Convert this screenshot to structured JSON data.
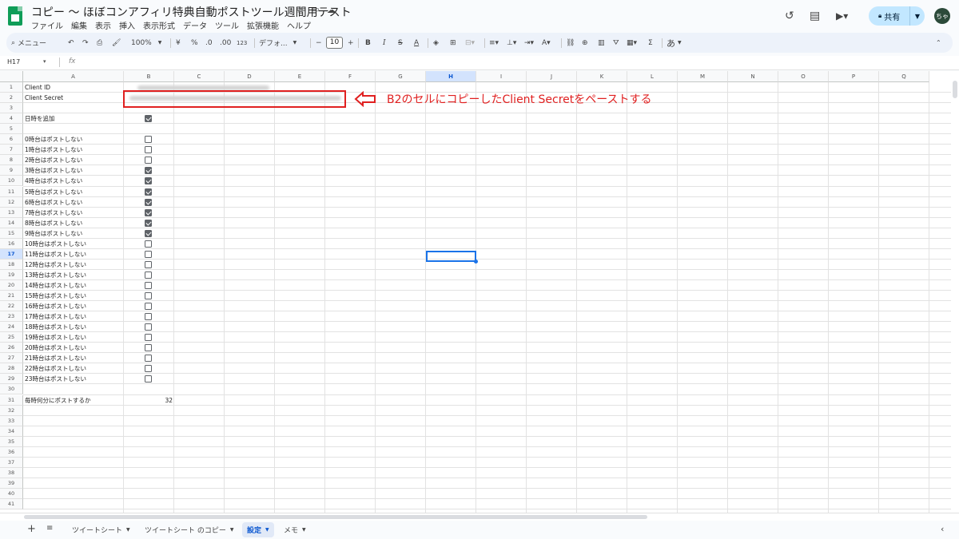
{
  "app": {
    "title": "コピー ～ ほぼコンアフィリ特典自動ポストツール週間用テスト",
    "menu": [
      "ファイル",
      "編集",
      "表示",
      "挿入",
      "表示形式",
      "データ",
      "ツール",
      "拡張機能",
      "ヘルプ"
    ],
    "share_label": "共有",
    "avatar": "ちゃ"
  },
  "toolbar": {
    "search": "メニュー",
    "zoom": "100%",
    "currency": "¥",
    "percent": "%",
    "dec_dec": ".0",
    "dec_inc": ".00",
    "num_format": "123",
    "font": "デフォ...",
    "font_size": "10",
    "minus": "−",
    "plus": "+",
    "bold": "B",
    "italic": "I",
    "input_tool": "あ"
  },
  "formula_bar": {
    "name_box": "H17",
    "fx": "fx"
  },
  "grid": {
    "columns": [
      "A",
      "B",
      "C",
      "D",
      "E",
      "F",
      "G",
      "H",
      "I",
      "J",
      "K",
      "L",
      "M",
      "N",
      "O",
      "P",
      "Q"
    ],
    "selected_column": "H",
    "selected_row": 17,
    "row_count": 41,
    "rows": [
      {
        "row": 1,
        "label": "Client ID",
        "value_blurred": true
      },
      {
        "row": 2,
        "label": "Client Secret",
        "value_blurred": true
      },
      {
        "row": 4,
        "label": "日時を追加",
        "checkbox": true
      },
      {
        "row": 6,
        "label": "0時台はポストしない",
        "checkbox": false
      },
      {
        "row": 7,
        "label": "1時台はポストしない",
        "checkbox": false
      },
      {
        "row": 8,
        "label": "2時台はポストしない",
        "checkbox": false
      },
      {
        "row": 9,
        "label": "3時台はポストしない",
        "checkbox": true
      },
      {
        "row": 10,
        "label": "4時台はポストしない",
        "checkbox": true
      },
      {
        "row": 11,
        "label": "5時台はポストしない",
        "checkbox": true
      },
      {
        "row": 12,
        "label": "6時台はポストしない",
        "checkbox": true
      },
      {
        "row": 13,
        "label": "7時台はポストしない",
        "checkbox": true
      },
      {
        "row": 14,
        "label": "8時台はポストしない",
        "checkbox": true
      },
      {
        "row": 15,
        "label": "9時台はポストしない",
        "checkbox": true
      },
      {
        "row": 16,
        "label": "10時台はポストしない",
        "checkbox": false
      },
      {
        "row": 17,
        "label": "11時台はポストしない",
        "checkbox": false
      },
      {
        "row": 18,
        "label": "12時台はポストしない",
        "checkbox": false
      },
      {
        "row": 19,
        "label": "13時台はポストしない",
        "checkbox": false
      },
      {
        "row": 20,
        "label": "14時台はポストしない",
        "checkbox": false
      },
      {
        "row": 21,
        "label": "15時台はポストしない",
        "checkbox": false
      },
      {
        "row": 22,
        "label": "16時台はポストしない",
        "checkbox": false
      },
      {
        "row": 23,
        "label": "17時台はポストしない",
        "checkbox": false
      },
      {
        "row": 24,
        "label": "18時台はポストしない",
        "checkbox": false
      },
      {
        "row": 25,
        "label": "19時台はポストしない",
        "checkbox": false
      },
      {
        "row": 26,
        "label": "20時台はポストしない",
        "checkbox": false
      },
      {
        "row": 27,
        "label": "21時台はポストしない",
        "checkbox": false
      },
      {
        "row": 28,
        "label": "22時台はポストしない",
        "checkbox": false
      },
      {
        "row": 29,
        "label": "23時台はポストしない",
        "checkbox": false
      },
      {
        "row": 31,
        "label": "毎時何分にポストするか",
        "number": "32"
      }
    ]
  },
  "annotation": {
    "text": "B2のセルにコピーしたClient Secretをペーストする",
    "color": "#e02020"
  },
  "sheet_tabs": [
    {
      "label": "ツイートシート",
      "active": false
    },
    {
      "label": "ツイートシート のコピー",
      "active": false
    },
    {
      "label": "設定",
      "active": true
    },
    {
      "label": "メモ",
      "active": false
    }
  ]
}
